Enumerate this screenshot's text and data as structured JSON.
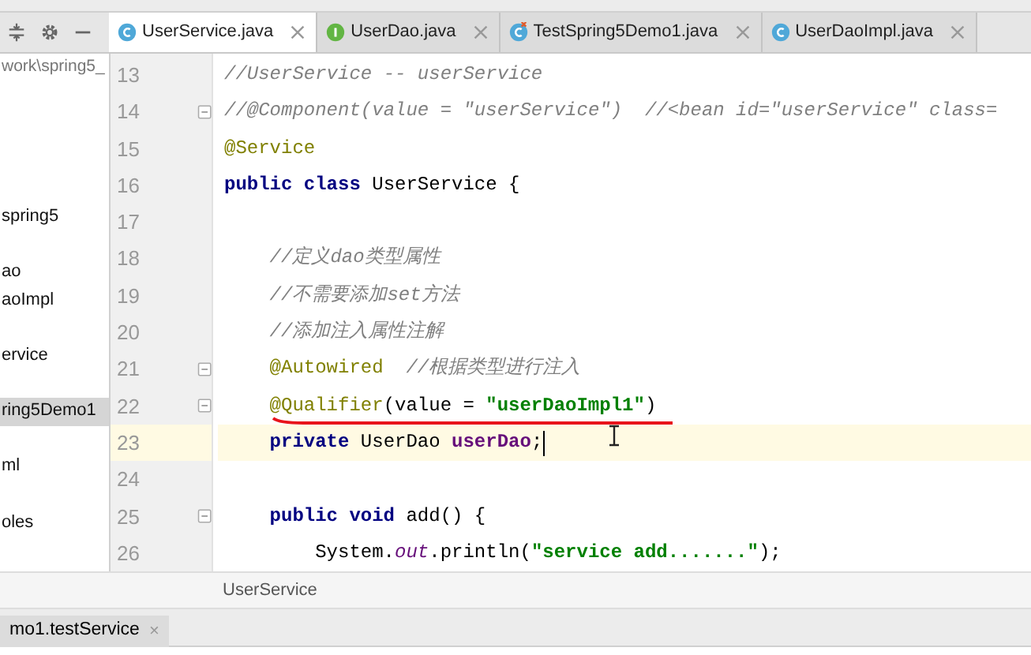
{
  "toolbar": {
    "buttons": [
      {
        "kind": "collapse"
      },
      {
        "kind": "gear"
      },
      {
        "kind": "minus"
      }
    ]
  },
  "tabs": [
    {
      "label": "UserService.java",
      "kind": "class",
      "selected": true
    },
    {
      "label": "UserDao.java",
      "kind": "interface",
      "selected": false
    },
    {
      "label": "TestSpring5Demo1.java",
      "kind": "test",
      "selected": false
    },
    {
      "label": "UserDaoImpl.java",
      "kind": "class",
      "selected": false
    }
  ],
  "project": {
    "path": "work\\spring5_",
    "items": [
      {
        "label": "spring5",
        "selected": false
      },
      {
        "label": "ao",
        "selected": false
      },
      {
        "label": "aoImpl",
        "selected": false
      },
      {
        "label": "ervice",
        "selected": false
      },
      {
        "label": "ring5Demo1",
        "selected": true
      },
      {
        "label": "ml",
        "selected": false
      },
      {
        "label": "oles",
        "selected": false
      }
    ]
  },
  "editor": {
    "lines": [
      {
        "number": "13",
        "kind": "top",
        "fold": false,
        "current": false,
        "tokens": [
          {
            "kind": "comment",
            "text": "//UserService -- userService"
          }
        ]
      },
      {
        "number": "14",
        "kind": "top",
        "fold": true,
        "current": false,
        "tokens": [
          {
            "kind": "comment",
            "text": "//@Component(value = \"userService\")  //<bean id=\"userService\" class="
          }
        ]
      },
      {
        "number": "15",
        "kind": "top",
        "fold": false,
        "current": false,
        "tokens": [
          {
            "kind": "annotation",
            "text": "@Service"
          }
        ]
      },
      {
        "number": "16",
        "kind": "top",
        "fold": false,
        "current": false,
        "tokens": [
          {
            "kind": "keyword",
            "text": "public class"
          },
          {
            "kind": "plain",
            "text": " UserService {"
          }
        ]
      },
      {
        "number": "17",
        "kind": "top",
        "fold": false,
        "current": false
      },
      {
        "number": "18",
        "kind": "member",
        "fold": false,
        "current": false,
        "tokens": [
          {
            "kind": "comment",
            "text": "//定义dao类型属性"
          }
        ]
      },
      {
        "number": "19",
        "kind": "member",
        "fold": false,
        "current": false,
        "tokens": [
          {
            "kind": "comment",
            "text": "//不需要添加set方法"
          }
        ]
      },
      {
        "number": "20",
        "kind": "member",
        "fold": false,
        "current": false,
        "tokens": [
          {
            "kind": "comment",
            "text": "//添加注入属性注解"
          }
        ]
      },
      {
        "number": "21",
        "kind": "member",
        "fold": true,
        "current": false,
        "tokens": [
          {
            "kind": "annotation",
            "text": "@Autowired"
          },
          {
            "kind": "comment",
            "text": "  //根据类型进行注入"
          }
        ]
      },
      {
        "number": "22",
        "kind": "member",
        "fold": true,
        "current": false,
        "underlined": true,
        "tokens": [
          {
            "kind": "annotation",
            "text": "@Qualifier"
          },
          {
            "kind": "plain",
            "text": "(value = "
          },
          {
            "kind": "string",
            "text": "\"userDaoImpl1\""
          },
          {
            "kind": "plain",
            "text": ")"
          }
        ]
      },
      {
        "number": "23",
        "kind": "member",
        "fold": false,
        "current": true,
        "tokens": [
          {
            "kind": "keyword",
            "text": "private"
          },
          {
            "kind": "plain",
            "text": " UserDao "
          },
          {
            "kind": "field",
            "text": "userDao"
          },
          {
            "kind": "plain",
            "text": ";"
          }
        ]
      },
      {
        "number": "24",
        "kind": "member",
        "fold": false,
        "current": false
      },
      {
        "number": "25",
        "kind": "member",
        "fold": true,
        "current": false,
        "tokens": [
          {
            "kind": "keyword",
            "text": "public void"
          },
          {
            "kind": "plain",
            "text": " add() {"
          }
        ]
      },
      {
        "number": "26",
        "kind": "body",
        "fold": false,
        "current": false,
        "tokens": [
          {
            "kind": "plain",
            "text": "System."
          },
          {
            "kind": "static",
            "text": "out"
          },
          {
            "kind": "plain",
            "text": ".println("
          },
          {
            "kind": "string",
            "text": "\"service add.......\""
          },
          {
            "kind": "plain",
            "text": ");"
          }
        ]
      }
    ]
  },
  "breadcrumb": "UserService",
  "run_tab": {
    "label": "mo1.testService",
    "close": "×"
  }
}
